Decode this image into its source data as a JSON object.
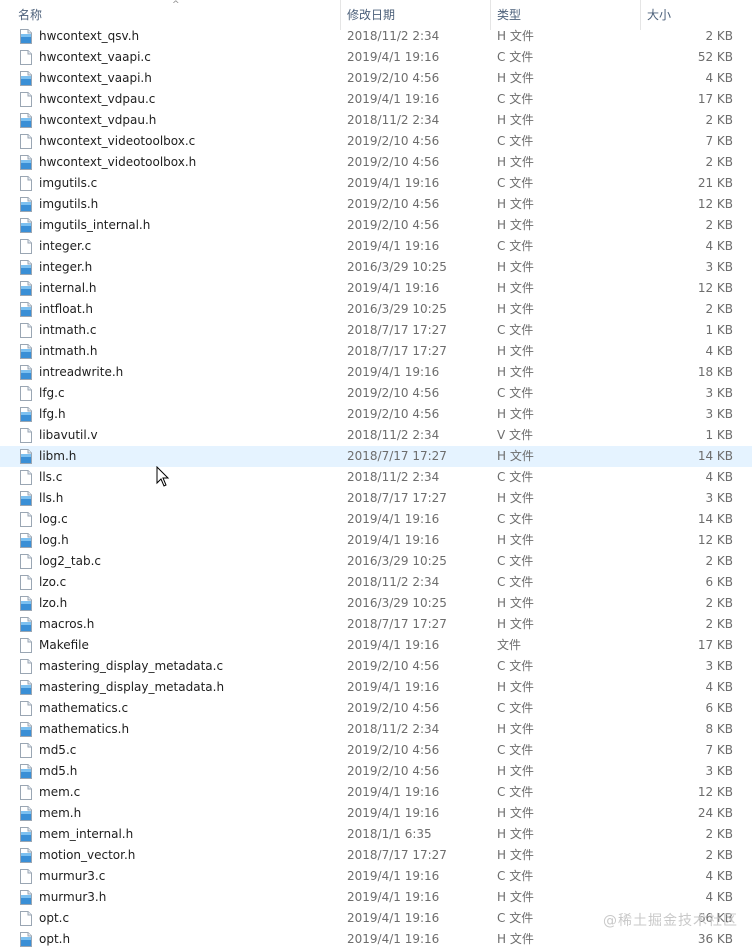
{
  "columns": {
    "name": "名称",
    "date": "修改日期",
    "type": "类型",
    "size": "大小"
  },
  "sort_indicator": "^",
  "files": [
    {
      "name": "hwcontext_qsv.h",
      "date": "2018/11/2 2:34",
      "type": "H 文件",
      "size": "2 KB",
      "icon": "header-file-icon"
    },
    {
      "name": "hwcontext_vaapi.c",
      "date": "2019/4/1 19:16",
      "type": "C 文件",
      "size": "52 KB",
      "icon": "c-file-icon"
    },
    {
      "name": "hwcontext_vaapi.h",
      "date": "2019/2/10 4:56",
      "type": "H 文件",
      "size": "4 KB",
      "icon": "header-file-icon"
    },
    {
      "name": "hwcontext_vdpau.c",
      "date": "2019/4/1 19:16",
      "type": "C 文件",
      "size": "17 KB",
      "icon": "c-file-icon"
    },
    {
      "name": "hwcontext_vdpau.h",
      "date": "2018/11/2 2:34",
      "type": "H 文件",
      "size": "2 KB",
      "icon": "header-file-icon"
    },
    {
      "name": "hwcontext_videotoolbox.c",
      "date": "2019/2/10 4:56",
      "type": "C 文件",
      "size": "7 KB",
      "icon": "c-file-icon"
    },
    {
      "name": "hwcontext_videotoolbox.h",
      "date": "2019/2/10 4:56",
      "type": "H 文件",
      "size": "2 KB",
      "icon": "header-file-icon"
    },
    {
      "name": "imgutils.c",
      "date": "2019/4/1 19:16",
      "type": "C 文件",
      "size": "21 KB",
      "icon": "c-file-icon"
    },
    {
      "name": "imgutils.h",
      "date": "2019/2/10 4:56",
      "type": "H 文件",
      "size": "12 KB",
      "icon": "header-file-icon"
    },
    {
      "name": "imgutils_internal.h",
      "date": "2019/2/10 4:56",
      "type": "H 文件",
      "size": "2 KB",
      "icon": "header-file-icon"
    },
    {
      "name": "integer.c",
      "date": "2019/4/1 19:16",
      "type": "C 文件",
      "size": "4 KB",
      "icon": "c-file-icon"
    },
    {
      "name": "integer.h",
      "date": "2016/3/29 10:25",
      "type": "H 文件",
      "size": "3 KB",
      "icon": "header-file-icon"
    },
    {
      "name": "internal.h",
      "date": "2019/4/1 19:16",
      "type": "H 文件",
      "size": "12 KB",
      "icon": "header-file-icon"
    },
    {
      "name": "intfloat.h",
      "date": "2016/3/29 10:25",
      "type": "H 文件",
      "size": "2 KB",
      "icon": "header-file-icon"
    },
    {
      "name": "intmath.c",
      "date": "2018/7/17 17:27",
      "type": "C 文件",
      "size": "1 KB",
      "icon": "c-file-icon"
    },
    {
      "name": "intmath.h",
      "date": "2018/7/17 17:27",
      "type": "H 文件",
      "size": "4 KB",
      "icon": "header-file-icon"
    },
    {
      "name": "intreadwrite.h",
      "date": "2019/4/1 19:16",
      "type": "H 文件",
      "size": "18 KB",
      "icon": "header-file-icon"
    },
    {
      "name": "lfg.c",
      "date": "2019/2/10 4:56",
      "type": "C 文件",
      "size": "3 KB",
      "icon": "c-file-icon"
    },
    {
      "name": "lfg.h",
      "date": "2019/2/10 4:56",
      "type": "H 文件",
      "size": "3 KB",
      "icon": "header-file-icon"
    },
    {
      "name": "libavutil.v",
      "date": "2018/11/2 2:34",
      "type": "V 文件",
      "size": "1 KB",
      "icon": "generic-file-icon"
    },
    {
      "name": "libm.h",
      "date": "2018/7/17 17:27",
      "type": "H 文件",
      "size": "14 KB",
      "icon": "header-file-icon",
      "selected": true
    },
    {
      "name": "lls.c",
      "date": "2018/11/2 2:34",
      "type": "C 文件",
      "size": "4 KB",
      "icon": "c-file-icon"
    },
    {
      "name": "lls.h",
      "date": "2018/7/17 17:27",
      "type": "H 文件",
      "size": "3 KB",
      "icon": "header-file-icon"
    },
    {
      "name": "log.c",
      "date": "2019/4/1 19:16",
      "type": "C 文件",
      "size": "14 KB",
      "icon": "c-file-icon"
    },
    {
      "name": "log.h",
      "date": "2019/4/1 19:16",
      "type": "H 文件",
      "size": "12 KB",
      "icon": "header-file-icon"
    },
    {
      "name": "log2_tab.c",
      "date": "2016/3/29 10:25",
      "type": "C 文件",
      "size": "2 KB",
      "icon": "c-file-icon"
    },
    {
      "name": "lzo.c",
      "date": "2018/11/2 2:34",
      "type": "C 文件",
      "size": "6 KB",
      "icon": "c-file-icon"
    },
    {
      "name": "lzo.h",
      "date": "2016/3/29 10:25",
      "type": "H 文件",
      "size": "2 KB",
      "icon": "header-file-icon"
    },
    {
      "name": "macros.h",
      "date": "2018/7/17 17:27",
      "type": "H 文件",
      "size": "2 KB",
      "icon": "header-file-icon"
    },
    {
      "name": "Makefile",
      "date": "2019/4/1 19:16",
      "type": "文件",
      "size": "17 KB",
      "icon": "generic-file-icon"
    },
    {
      "name": "mastering_display_metadata.c",
      "date": "2019/2/10 4:56",
      "type": "C 文件",
      "size": "3 KB",
      "icon": "c-file-icon"
    },
    {
      "name": "mastering_display_metadata.h",
      "date": "2019/4/1 19:16",
      "type": "H 文件",
      "size": "4 KB",
      "icon": "header-file-icon"
    },
    {
      "name": "mathematics.c",
      "date": "2019/2/10 4:56",
      "type": "C 文件",
      "size": "6 KB",
      "icon": "c-file-icon"
    },
    {
      "name": "mathematics.h",
      "date": "2018/11/2 2:34",
      "type": "H 文件",
      "size": "8 KB",
      "icon": "header-file-icon"
    },
    {
      "name": "md5.c",
      "date": "2019/2/10 4:56",
      "type": "C 文件",
      "size": "7 KB",
      "icon": "c-file-icon"
    },
    {
      "name": "md5.h",
      "date": "2019/2/10 4:56",
      "type": "H 文件",
      "size": "3 KB",
      "icon": "header-file-icon"
    },
    {
      "name": "mem.c",
      "date": "2019/4/1 19:16",
      "type": "C 文件",
      "size": "12 KB",
      "icon": "c-file-icon"
    },
    {
      "name": "mem.h",
      "date": "2019/4/1 19:16",
      "type": "H 文件",
      "size": "24 KB",
      "icon": "header-file-icon"
    },
    {
      "name": "mem_internal.h",
      "date": "2018/1/1 6:35",
      "type": "H 文件",
      "size": "2 KB",
      "icon": "header-file-icon"
    },
    {
      "name": "motion_vector.h",
      "date": "2018/7/17 17:27",
      "type": "H 文件",
      "size": "2 KB",
      "icon": "header-file-icon"
    },
    {
      "name": "murmur3.c",
      "date": "2019/4/1 19:16",
      "type": "C 文件",
      "size": "4 KB",
      "icon": "c-file-icon"
    },
    {
      "name": "murmur3.h",
      "date": "2019/4/1 19:16",
      "type": "H 文件",
      "size": "4 KB",
      "icon": "header-file-icon"
    },
    {
      "name": "opt.c",
      "date": "2019/4/1 19:16",
      "type": "C 文件",
      "size": "66 KB",
      "icon": "c-file-icon"
    },
    {
      "name": "opt.h",
      "date": "2019/4/1 19:16",
      "type": "H 文件",
      "size": "36 KB",
      "icon": "header-file-icon"
    }
  ],
  "watermark": "@稀土掘金技术社区",
  "colors": {
    "selected_row": "#e5f3ff",
    "header_text": "#4c607a",
    "icon_blue": "#3a8fd6"
  }
}
